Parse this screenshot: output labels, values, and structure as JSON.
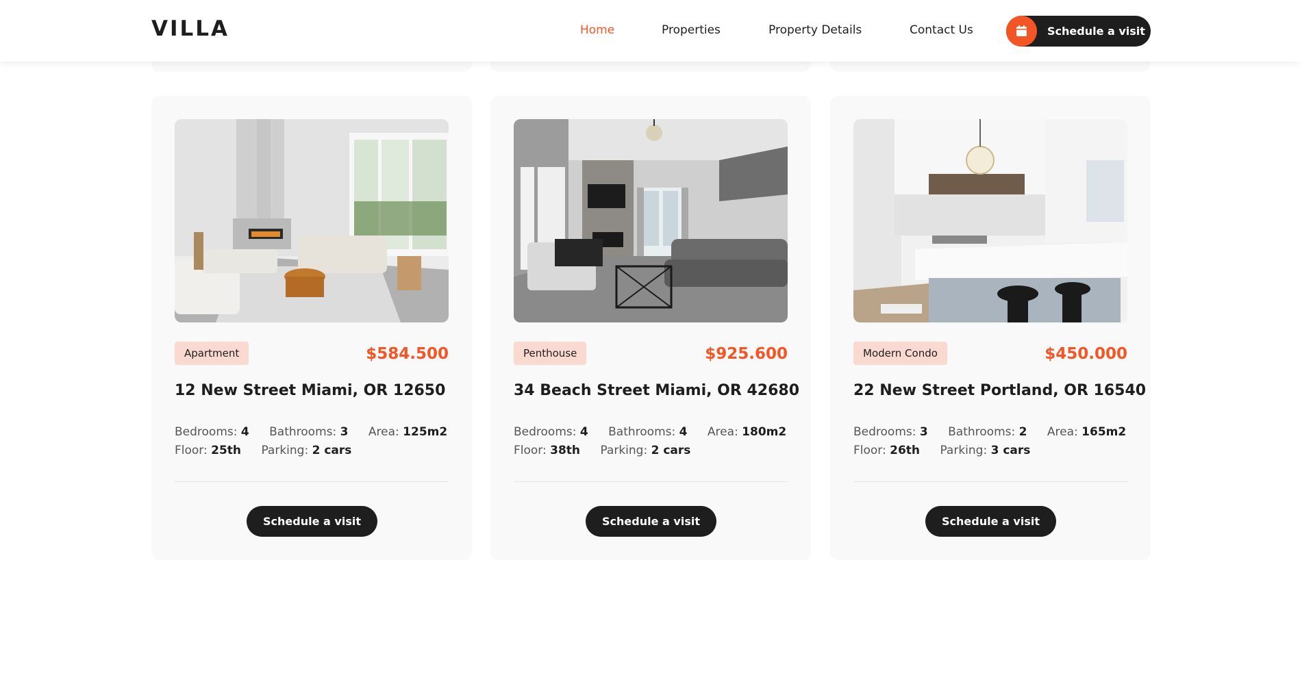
{
  "header": {
    "logo": "VILLA",
    "nav": [
      {
        "label": "Home",
        "active": true
      },
      {
        "label": "Properties",
        "active": false
      },
      {
        "label": "Property Details",
        "active": false
      },
      {
        "label": "Contact Us",
        "active": false
      }
    ],
    "cta_label": "Schedule a visit",
    "cta_icon": "calendar-icon"
  },
  "colors": {
    "accent": "#f35525",
    "dark": "#1e1e1e",
    "tag_bg": "#fad9d0",
    "card_bg": "#f9f9f9"
  },
  "properties": [
    {
      "type": "Apartment",
      "price": "$584.500",
      "address": "12 New Street Miami, OR 12650",
      "bedrooms_label": "Bedrooms:",
      "bedrooms": "4",
      "bathrooms_label": "Bathrooms:",
      "bathrooms": "3",
      "area_label": "Area:",
      "area": "125m2",
      "floor_label": "Floor:",
      "floor": "25th",
      "parking_label": "Parking:",
      "parking": "2 cars",
      "button": "Schedule a visit"
    },
    {
      "type": "Penthouse",
      "price": "$925.600",
      "address": "34 Beach Street Miami, OR 42680",
      "bedrooms_label": "Bedrooms:",
      "bedrooms": "4",
      "bathrooms_label": "Bathrooms:",
      "bathrooms": "4",
      "area_label": "Area:",
      "area": "180m2",
      "floor_label": "Floor:",
      "floor": "38th",
      "parking_label": "Parking:",
      "parking": "2 cars",
      "button": "Schedule a visit"
    },
    {
      "type": "Modern Condo",
      "price": "$450.000",
      "address": "22 New Street Portland, OR 16540",
      "bedrooms_label": "Bedrooms:",
      "bedrooms": "3",
      "bathrooms_label": "Bathrooms:",
      "bathrooms": "2",
      "area_label": "Area:",
      "area": "165m2",
      "floor_label": "Floor:",
      "floor": "26th",
      "parking_label": "Parking:",
      "parking": "3 cars",
      "button": "Schedule a visit"
    }
  ]
}
